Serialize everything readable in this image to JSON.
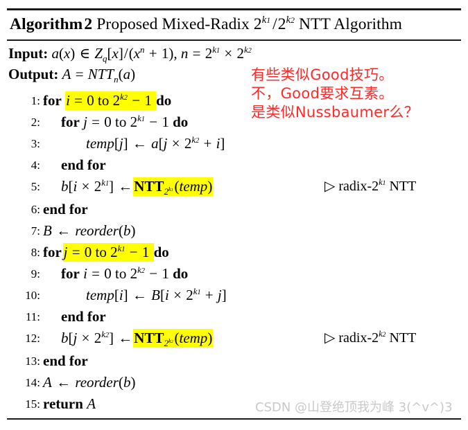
{
  "algorithm": {
    "label": "Algorithm",
    "number": "2",
    "title_rest": "Proposed Mixed-Radix 2^{k_1}/2^{k_2} NTT Algorithm",
    "title_plain": "Algorithm 2 Proposed Mixed-Radix 2^k1 / 2^k2 NTT Algorithm",
    "input_label": "Input:",
    "input_text": "a(x) ∈ Z_q[x]/(x^n + 1), n = 2^{k_1} × 2^{k_2}",
    "output_label": "Output:",
    "output_text": "A = NTT_n(a)",
    "lines": [
      {
        "no": "1:",
        "indent": 0,
        "text": "for i = 0 to 2^{k_2} − 1 do",
        "highlight": "i = 0 to 2^{k_2} − 1",
        "comment": ""
      },
      {
        "no": "2:",
        "indent": 1,
        "text": "for j = 0 to 2^{k_1} − 1 do",
        "highlight": "",
        "comment": ""
      },
      {
        "no": "3:",
        "indent": 2,
        "text": "temp[j] ← a[j × 2^{k_2} + i]",
        "highlight": "",
        "comment": ""
      },
      {
        "no": "4:",
        "indent": 1,
        "text": "end for",
        "highlight": "",
        "comment": ""
      },
      {
        "no": "5:",
        "indent": 1,
        "text": "b[i × 2^{k_1}] ← NTT_{2^{k_1}}(temp)",
        "highlight": "NTT_{2^{k_1}}(temp)",
        "comment": "▹ radix-2^{k_1} NTT"
      },
      {
        "no": "6:",
        "indent": 0,
        "text": "end for",
        "highlight": "",
        "comment": ""
      },
      {
        "no": "7:",
        "indent": 0,
        "text": "B ← reorder(b)",
        "highlight": "",
        "comment": ""
      },
      {
        "no": "8:",
        "indent": 0,
        "text": "for j = 0 to 2^{k_1} − 1 do",
        "highlight": "j = 0 to 2^{k_1} − 1",
        "comment": ""
      },
      {
        "no": "9:",
        "indent": 1,
        "text": "for i = 0 to 2^{k_2} − 1 do",
        "highlight": "",
        "comment": ""
      },
      {
        "no": "10:",
        "indent": 2,
        "text": "temp[i] ← B[i × 2^{k_1} + j]",
        "highlight": "",
        "comment": ""
      },
      {
        "no": "11:",
        "indent": 1,
        "text": "end for",
        "highlight": "",
        "comment": ""
      },
      {
        "no": "12:",
        "indent": 1,
        "text": "b[j × 2^{k_2}] ← NTT_{2^{k_2}}(temp)",
        "highlight": "NTT_{2^{k_2}}(temp)",
        "comment": "▹ radix-2^{k_2} NTT"
      },
      {
        "no": "13:",
        "indent": 0,
        "text": "end for",
        "highlight": "",
        "comment": ""
      },
      {
        "no": "14:",
        "indent": 0,
        "text": "A ← reorder(b)",
        "highlight": "",
        "comment": ""
      },
      {
        "no": "15:",
        "indent": 0,
        "text": "return A",
        "highlight": "",
        "comment": ""
      }
    ]
  },
  "annotation": {
    "color": "#ff2a2a",
    "line1": "有些类似Good技巧。",
    "line2": "不，Good要求互素。",
    "line3": "是类似Nussbaumer么？"
  },
  "watermark": {
    "text": "CSDN @山登绝顶我为峰 3(^v^)3",
    "color": "#c9c9c9"
  },
  "line_numbers": [
    "1:",
    "2:",
    "3:",
    "4:",
    "5:",
    "6:",
    "7:",
    "8:",
    "9:",
    "10:",
    "11:",
    "12:",
    "13:",
    "14:",
    "15:"
  ],
  "comments": {
    "line5": "radix-2^{k_1} NTT",
    "line12": "radix-2^{k_2} NTT"
  }
}
